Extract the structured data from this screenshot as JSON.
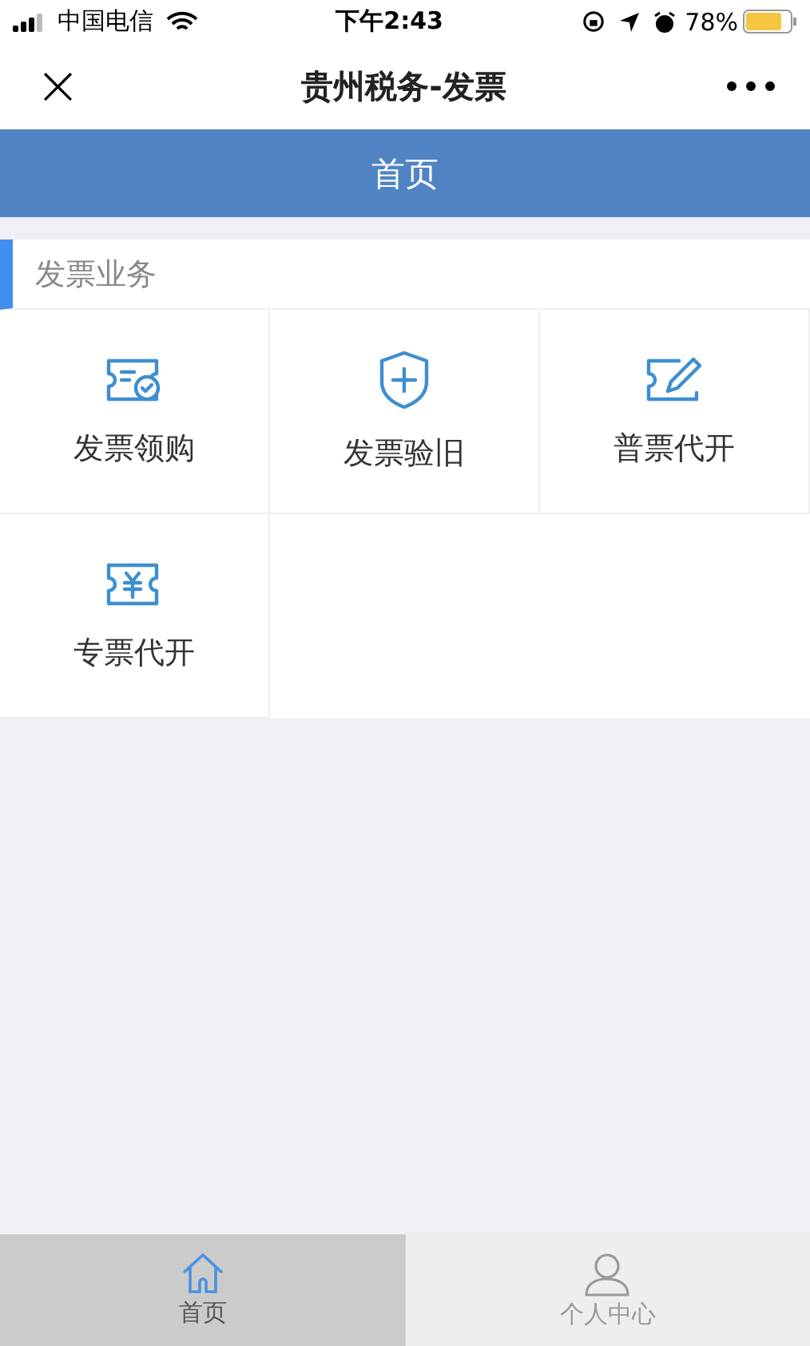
{
  "status_bar": {
    "carrier": "中国电信",
    "time": "下午2:43",
    "battery": "78%"
  },
  "nav_bar": {
    "close": "×",
    "title": "贵州税务-发票"
  },
  "header": {
    "title": "首页"
  },
  "section": {
    "title": "发票业务"
  },
  "services": [
    {
      "label": "发票领购"
    },
    {
      "label": "发票验旧"
    },
    {
      "label": "普票代开"
    },
    {
      "label": "专票代开"
    }
  ],
  "tab_bar": [
    {
      "label": "首页",
      "selected": true
    },
    {
      "label": "个人中心",
      "selected": false
    }
  ]
}
